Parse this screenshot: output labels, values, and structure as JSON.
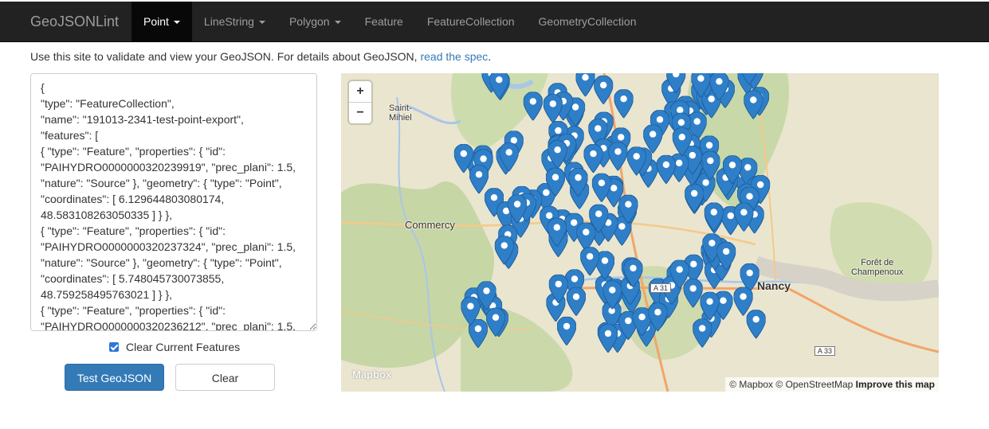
{
  "navbar": {
    "brand": "GeoJSONLint",
    "items": [
      {
        "label": "Point",
        "dropdown": true,
        "active": true
      },
      {
        "label": "LineString",
        "dropdown": true,
        "active": false
      },
      {
        "label": "Polygon",
        "dropdown": true,
        "active": false
      },
      {
        "label": "Feature",
        "dropdown": false,
        "active": false
      },
      {
        "label": "FeatureCollection",
        "dropdown": false,
        "active": false
      },
      {
        "label": "GeometryCollection",
        "dropdown": false,
        "active": false
      }
    ]
  },
  "intro": {
    "text": "Use this site to validate and view your GeoJSON. For details about GeoJSON,",
    "link": "read the spec",
    "end": "."
  },
  "editor": {
    "value": "{\n\"type\": \"FeatureCollection\",\n\"name\": \"191013-2341-test-point-export\",\n\"features\": [\n{ \"type\": \"Feature\", \"properties\": { \"id\": \"PAIHYDRO0000000320239919\", \"prec_plani\": 1.5, \"nature\": \"Source\" }, \"geometry\": { \"type\": \"Point\", \"coordinates\": [ 6.129644803080174, 48.583108263050335 ] } },\n{ \"type\": \"Feature\", \"properties\": { \"id\": \"PAIHYDRO0000000320237324\", \"prec_plani\": 1.5, \"nature\": \"Source\" }, \"geometry\": { \"type\": \"Point\", \"coordinates\": [ 5.748045730073855, 48.759258495763021 ] } },\n{ \"type\": \"Feature\", \"properties\": { \"id\": \"PAIHYDRO0000000320236212\", \"prec_plani\": 1.5,"
  },
  "clear_features": {
    "label": "Clear Current Features",
    "checked": true
  },
  "buttons": {
    "test": "Test GeoJSON",
    "clear": "Clear"
  },
  "map": {
    "zoom_in": "+",
    "zoom_out": "−",
    "labels": {
      "saint_mihiel": "Saint-\nMihiel",
      "commercy": "Commercy",
      "nancy": "Nancy",
      "foret": "Forêt de\nChampenoux",
      "a31": "A 31",
      "a33": "A 33"
    },
    "logo": "Mapbox",
    "attribution": {
      "mapbox": "© Mapbox",
      "osm": "© OpenStreetMap",
      "improve": "Improve this map"
    },
    "marker_color": "#2f7fc8"
  }
}
